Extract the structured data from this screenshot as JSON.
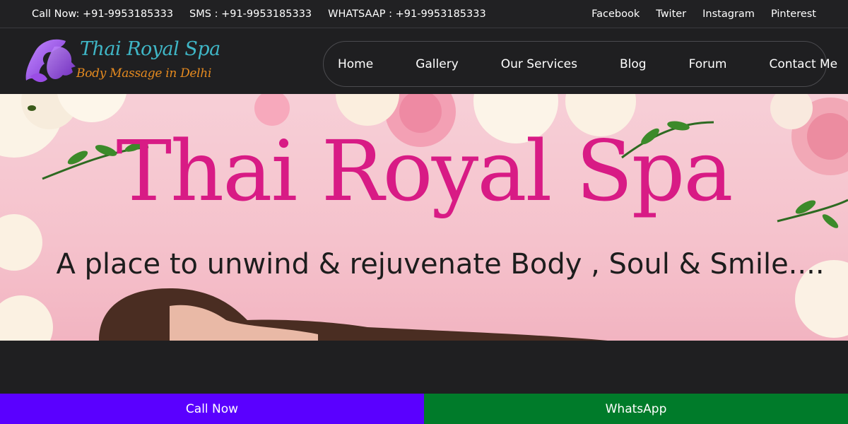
{
  "topbar": {
    "call": "Call Now: +91-9953185333",
    "sms": "SMS : +91-9953185333",
    "whatsapp": "WHATSAAP : +91-9953185333",
    "social": [
      "Facebook",
      "Twiter",
      "Instagram",
      "Pinterest"
    ]
  },
  "logo": {
    "title": "Thai Royal Spa",
    "tagline": "Body Massage in Delhi",
    "icon": "woman-face-icon"
  },
  "nav": {
    "items": [
      "Home",
      "Gallery",
      "Our Services",
      "Blog",
      "Forum",
      "Contact Me"
    ]
  },
  "hero": {
    "title": "Thai Royal Spa",
    "subtitle": "A place to unwind & rejuvenate Body , Soul & Smile...."
  },
  "cta": {
    "call_label": "Call Now",
    "whatsapp_label": "WhatsApp"
  },
  "colors": {
    "background": "#1f1f21",
    "call_button": "#5a00ff",
    "whatsapp_button": "#007b2a",
    "brand_pink": "#d81b85",
    "logo_teal": "#3fb6c6",
    "logo_orange": "#e58a1f"
  }
}
